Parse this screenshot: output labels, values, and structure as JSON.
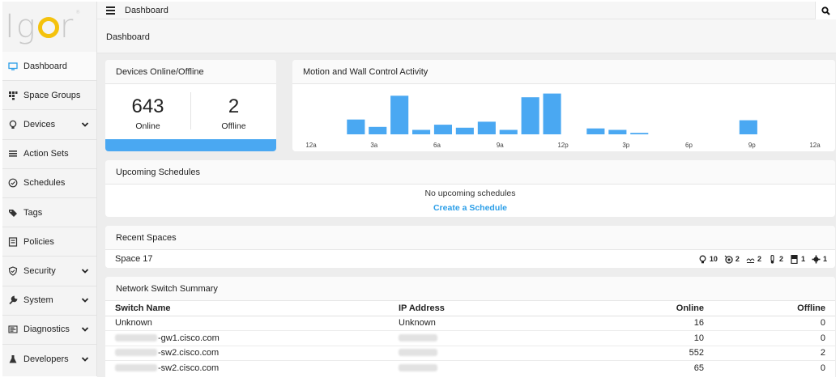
{
  "logo": {
    "text_left": "Ig",
    "text_right": "r",
    "mark": "®"
  },
  "colors": {
    "accent": "#4aa8f2",
    "link": "#2b9ee8",
    "logo_yellow": "#f4c20d",
    "sidebar_bg": "#f4f4f4",
    "content_bg": "#ededed"
  },
  "sidebar": {
    "items": [
      {
        "label": "Dashboard",
        "icon": "monitor-icon",
        "expandable": false,
        "active": true
      },
      {
        "label": "Space Groups",
        "icon": "grid-icon",
        "expandable": false
      },
      {
        "label": "Devices",
        "icon": "lightbulb-icon",
        "expandable": true
      },
      {
        "label": "Action Sets",
        "icon": "list-icon",
        "expandable": false
      },
      {
        "label": "Schedules",
        "icon": "clock-icon",
        "expandable": false
      },
      {
        "label": "Tags",
        "icon": "tag-icon",
        "expandable": false
      },
      {
        "label": "Policies",
        "icon": "document-icon",
        "expandable": false
      },
      {
        "label": "Security",
        "icon": "shield-icon",
        "expandable": true
      },
      {
        "label": "System",
        "icon": "wrench-icon",
        "expandable": true
      },
      {
        "label": "Diagnostics",
        "icon": "chart-list-icon",
        "expandable": true
      },
      {
        "label": "Developers",
        "icon": "flask-icon",
        "expandable": true
      }
    ]
  },
  "topbar": {
    "title": "Dashboard"
  },
  "page": {
    "title": "Dashboard"
  },
  "devices": {
    "title": "Devices Online/Offline",
    "online_count": "643",
    "online_label": "Online",
    "offline_count": "2",
    "offline_label": "Offline"
  },
  "motion": {
    "title": "Motion and Wall Control Activity"
  },
  "chart_data": {
    "type": "bar",
    "title": "Motion and Wall Control Activity",
    "tick_labels": [
      "12a",
      "3a",
      "6a",
      "9a",
      "12p",
      "3p",
      "6p",
      "9p",
      "12a"
    ],
    "hours": [
      1,
      2,
      3,
      4,
      5,
      6,
      7,
      8,
      9,
      10,
      11,
      12,
      13,
      14,
      15,
      16,
      17,
      18,
      19,
      20,
      21,
      22,
      23,
      24
    ],
    "values": [
      0,
      0,
      20,
      10,
      52,
      6,
      13,
      9,
      17,
      6,
      50,
      55,
      0,
      8,
      6,
      2,
      0,
      0,
      0,
      0,
      19,
      0,
      0,
      0
    ],
    "ylim": [
      0,
      60
    ],
    "grid": false,
    "legend": "none"
  },
  "upcoming": {
    "title": "Upcoming Schedules",
    "empty_text": "No upcoming schedules",
    "create_link": "Create a Schedule"
  },
  "recent": {
    "title": "Recent Spaces",
    "space_name": "Space 17",
    "stats": [
      {
        "icon": "lightbulb-icon",
        "value": "10"
      },
      {
        "icon": "motion-sensor-icon",
        "value": "2"
      },
      {
        "icon": "daylight-sensor-icon",
        "value": "2"
      },
      {
        "icon": "thermometer-icon",
        "value": "2"
      },
      {
        "icon": "window-shade-icon",
        "value": "1"
      },
      {
        "icon": "gear-icon",
        "value": "1"
      }
    ]
  },
  "network": {
    "title": "Network Switch Summary",
    "columns": [
      "Switch Name",
      "IP Address",
      "Online",
      "Offline"
    ],
    "rows": [
      {
        "name": "Unknown",
        "name_redacted": false,
        "ip": "Unknown",
        "ip_redacted": false,
        "online": "16",
        "offline": "0"
      },
      {
        "name": "-gw1.cisco.com",
        "name_redacted": true,
        "ip": "",
        "ip_redacted": true,
        "online": "10",
        "offline": "0"
      },
      {
        "name": "-sw2.cisco.com",
        "name_redacted": true,
        "ip": "",
        "ip_redacted": true,
        "online": "552",
        "offline": "2"
      },
      {
        "name": "-sw2.cisco.com",
        "name_redacted": true,
        "ip": "",
        "ip_redacted": true,
        "online": "65",
        "offline": "0"
      }
    ]
  }
}
